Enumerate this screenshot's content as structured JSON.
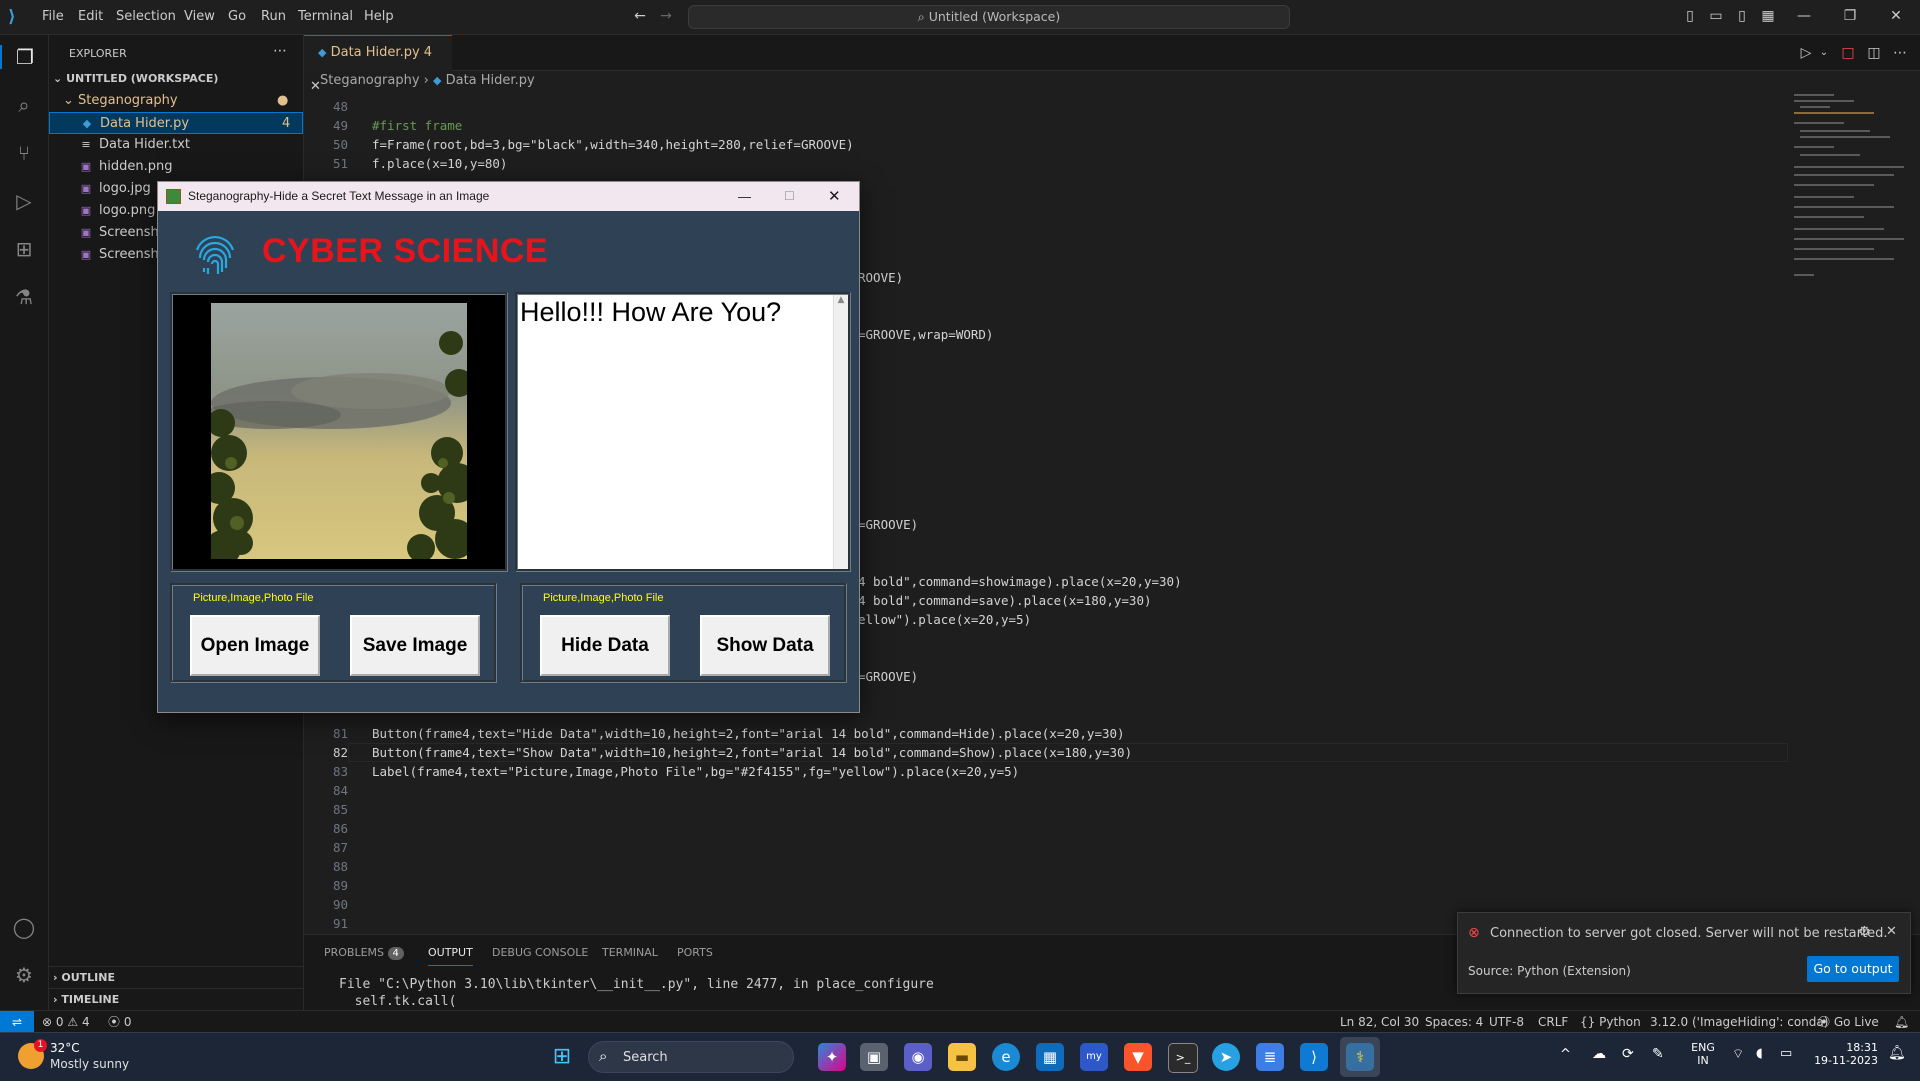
{
  "titlebar": {
    "menu": [
      "File",
      "Edit",
      "Selection",
      "View",
      "Go",
      "Run",
      "Terminal",
      "Help"
    ],
    "command_center": "Untitled (Workspace)"
  },
  "sidebar": {
    "title": "EXPLORER",
    "workspace": "UNTITLED (WORKSPACE)",
    "folder": "Steganography",
    "files": [
      {
        "name": "Data Hider.py",
        "badge": "4",
        "icon": "python-file-icon",
        "active": true
      },
      {
        "name": "Data Hider.txt",
        "badge": "",
        "icon": "text-file-icon",
        "active": false
      },
      {
        "name": "hidden.png",
        "badge": "",
        "icon": "image-file-icon",
        "active": false
      },
      {
        "name": "logo.jpg",
        "badge": "",
        "icon": "image-file-icon",
        "active": false
      },
      {
        "name": "logo.png",
        "badge": "",
        "icon": "image-file-icon",
        "active": false
      },
      {
        "name": "Screenshot",
        "badge": "",
        "icon": "image-file-icon",
        "active": false
      },
      {
        "name": "Screenshot",
        "badge": "",
        "icon": "image-file-icon",
        "active": false
      }
    ],
    "outline": "OUTLINE",
    "timeline": "TIMELINE"
  },
  "editor": {
    "tab_name": "Data Hider.py",
    "tab_badge": "4",
    "breadcrumb_folder": "Steganography",
    "breadcrumb_file": "Data Hider.py",
    "lines": [
      {
        "n": "48",
        "text": ""
      },
      {
        "n": "49",
        "text": "#first frame"
      },
      {
        "n": "50",
        "text": "f=Frame(root,bd=3,bg=\"black\",width=340,height=280,relief=GROOVE)"
      },
      {
        "n": "51",
        "text": "f.place(x=10,y=80)"
      },
      {
        "n": "81",
        "text": "Button(frame4,text=\"Hide Data\",width=10,height=2,font=\"arial 14 bold\",command=Hide).place(x=20,y=30)"
      },
      {
        "n": "82",
        "text": "Button(frame4,text=\"Show Data\",width=10,height=2,font=\"arial 14 bold\",command=Show).place(x=180,y=30)"
      },
      {
        "n": "83",
        "text": "Label(frame4,text=\"Picture,Image,Photo File\",bg=\"#2f4155\",fg=\"yellow\").place(x=20,y=5)"
      },
      {
        "n": "84",
        "text": ""
      },
      {
        "n": "85",
        "text": ""
      },
      {
        "n": "86",
        "text": ""
      },
      {
        "n": "87",
        "text": ""
      },
      {
        "n": "88",
        "text": ""
      },
      {
        "n": "89",
        "text": ""
      },
      {
        "n": "90",
        "text": ""
      },
      {
        "n": "91",
        "text": ""
      }
    ],
    "fragments": {
      "f1": "ROOVE)",
      "f2": "=GROOVE,wrap=WORD)",
      "f3": "=GROOVE)",
      "f4": "4 bold\",command=showimage).place(x=20,y=30)",
      "f5": "4 bold\",command=save).place(x=180,y=30)",
      "f6": "ellow\").place(x=20,y=5)",
      "f7": "=GROOVE)"
    }
  },
  "panel": {
    "tabs": [
      "PROBLEMS",
      "OUTPUT",
      "DEBUG CONSOLE",
      "TERMINAL",
      "PORTS"
    ],
    "problems_count": "4",
    "output_lines": [
      "File \"C:\\Python 3.10\\lib\\tkinter\\__init__.py\", line 2477, in place_configure",
      "  self.tk.call("
    ]
  },
  "notification": {
    "message": "Connection to server got closed. Server will not be restarted.",
    "source": "Source: Python (Extension)",
    "button": "Go to output"
  },
  "statusbar": {
    "errors": "0",
    "warnings": "4",
    "ports": "0",
    "position": "Ln 82, Col 30",
    "spaces": "Spaces: 4",
    "encoding": "UTF-8",
    "eol": "CRLF",
    "language": "Python",
    "interpreter": "3.12.0 ('ImageHiding': conda)",
    "golive": "Go Live"
  },
  "taskbar": {
    "weather_temp": "32°C",
    "weather_desc": "Mostly sunny",
    "weather_badge": "1",
    "search": "Search",
    "lang1": "ENG",
    "lang2": "IN",
    "time": "18:31",
    "date": "19-11-2023"
  },
  "tkapp": {
    "window_title": "Steganography-Hide a Secret Text Message in an Image",
    "brand": "CYBER SCIENCE",
    "text_content": "Hello!!! How Are You?",
    "frame3_label": "Picture,Image,Photo File",
    "frame4_label": "Picture,Image,Photo File",
    "open_button": "Open Image",
    "save_button": "Save Image",
    "hide_button": "Hide Data",
    "show_button": "Show Data"
  },
  "colors": {
    "accent": "#0078d4",
    "tk_bg": "#2f4155",
    "brand_red": "#e8141c",
    "label_yellow": "#ffff00"
  }
}
